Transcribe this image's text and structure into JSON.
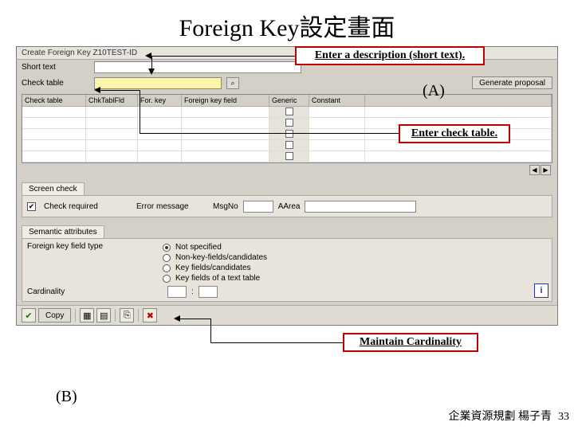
{
  "slide": {
    "title": "Foreign Key設定畫面",
    "footer": "企業資源規劃 楊子青",
    "page": "33"
  },
  "callouts": {
    "c1": "Enter a description (short text).",
    "c2": "Enter check table.",
    "c3": "Maintain Cardinality",
    "markerA": "(A)",
    "markerB": "(B)"
  },
  "titlebar": "Create Foreign Key Z10TEST-ID",
  "form": {
    "short_text_label": "Short text",
    "check_table_label": "Check table",
    "generate_proposal": "Generate proposal"
  },
  "grid": {
    "headers": [
      "Check table",
      "ChkTablFld",
      "For. key",
      "Foreign key field",
      "Generic",
      "Constant",
      ""
    ]
  },
  "screen_check": {
    "tab": "Screen check",
    "check_required": "Check required",
    "error_message_label": "Error message",
    "msgno_label": "MsgNo",
    "aarea_label": "AArea"
  },
  "semantic": {
    "tab": "Semantic attributes",
    "fk_type_label": "Foreign key field type",
    "opts": [
      "Not specified",
      "Non-key-fields/candidates",
      "Key fields/candidates",
      "Key fields of a text table"
    ],
    "cardinality_label": "Cardinality",
    "info": "i"
  },
  "toolbar": {
    "copy": "Copy",
    "check": "✔",
    "cancel": "✖"
  }
}
